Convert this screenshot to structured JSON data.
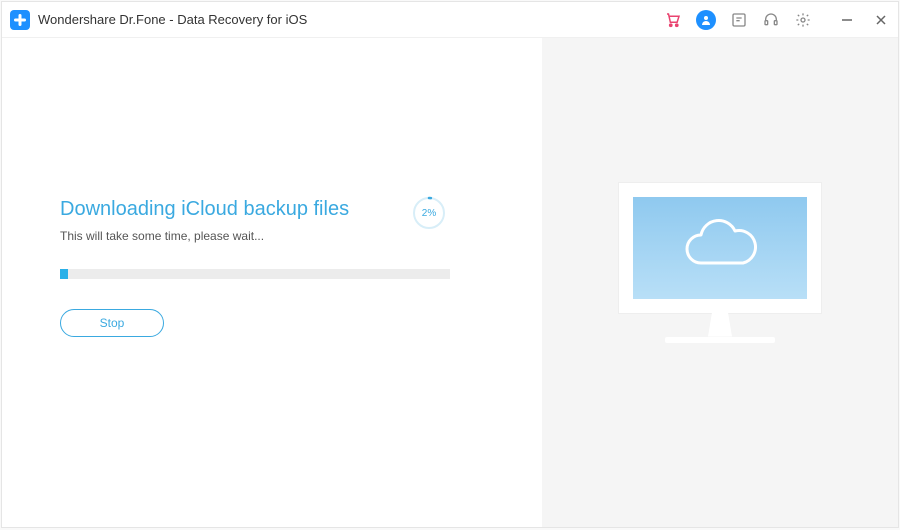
{
  "app": {
    "title": "Wondershare Dr.Fone - Data Recovery for iOS"
  },
  "main": {
    "heading": "Downloading iCloud backup files",
    "subtitle": "This will take some time, please wait...",
    "progress_percent": 2,
    "progress_label": "2%",
    "stop_label": "Stop"
  },
  "colors": {
    "accent": "#3aa9e0",
    "cart": "#e9436f",
    "avatar_bg": "#1e90ff"
  }
}
